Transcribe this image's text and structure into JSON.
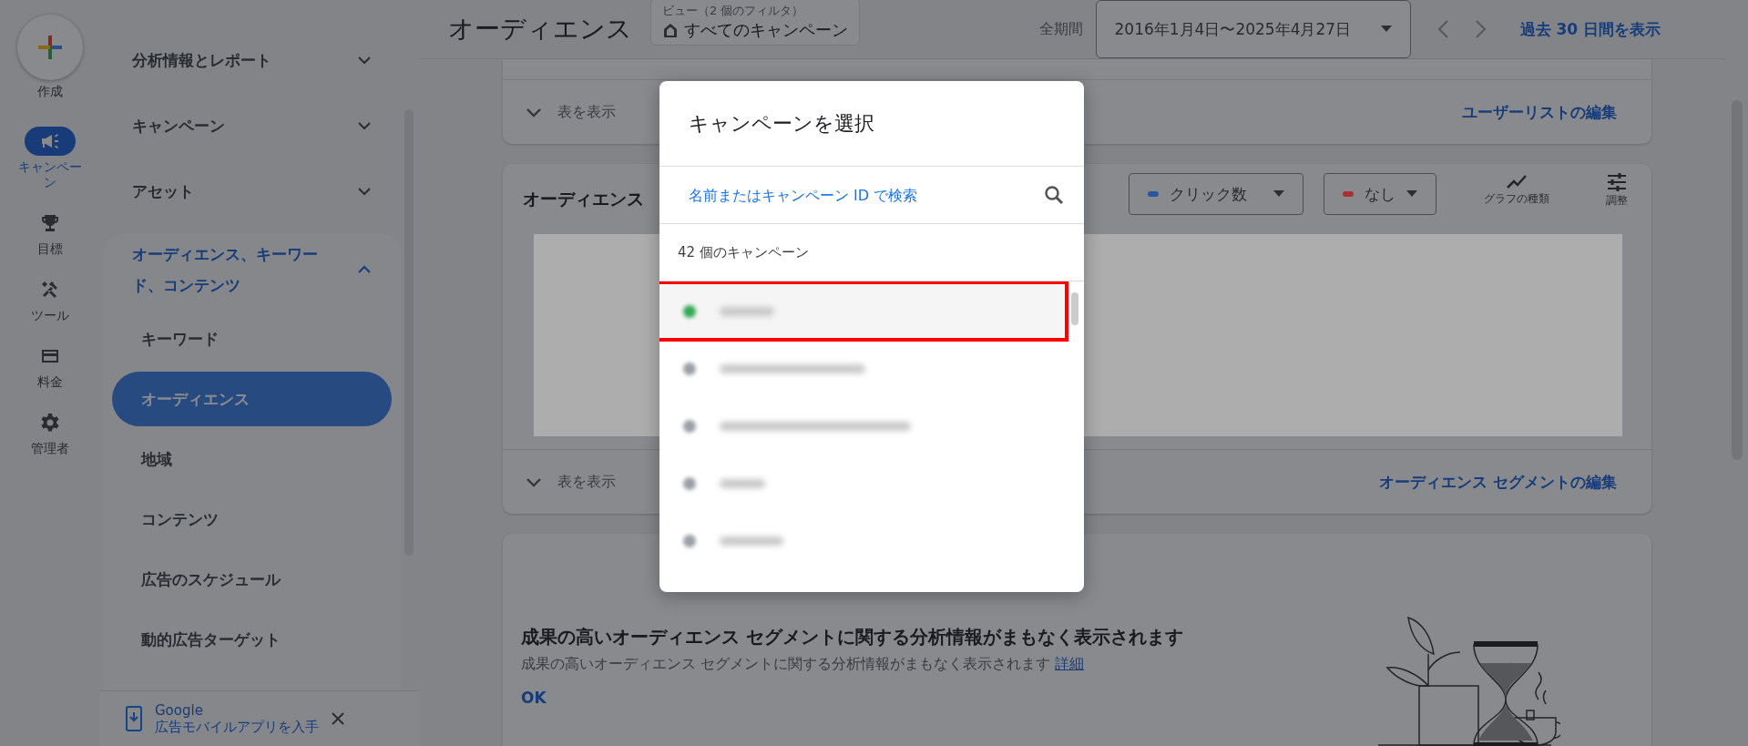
{
  "rail": {
    "create_label": "作成",
    "items": [
      {
        "label": "キャンペーン",
        "kind": "campaign",
        "selected": true
      },
      {
        "label": "目標",
        "kind": "goal",
        "selected": false
      },
      {
        "label": "ツール",
        "kind": "tools",
        "selected": false
      },
      {
        "label": "料金",
        "kind": "billing",
        "selected": false
      },
      {
        "label": "管理者",
        "kind": "admin",
        "selected": false
      }
    ]
  },
  "nav": {
    "items": [
      {
        "label": "分析情報とレポート",
        "expanded": false
      },
      {
        "label": "キャンペーン",
        "expanded": false
      },
      {
        "label": "アセット",
        "expanded": false
      },
      {
        "label": "オーディエンス、キーワード、コンテンツ",
        "expanded": true,
        "children": [
          {
            "label": "キーワード",
            "selected": false
          },
          {
            "label": "オーディエンス",
            "selected": true
          },
          {
            "label": "地域",
            "selected": false
          },
          {
            "label": "コンテンツ",
            "selected": false
          },
          {
            "label": "広告のスケジュール",
            "selected": false
          },
          {
            "label": "動的広告ターゲット",
            "selected": false
          }
        ]
      }
    ]
  },
  "promo": {
    "line_1": "Google",
    "line_2": "広告モバイルアプリを入手"
  },
  "header": {
    "title": "オーディエンス",
    "view_label": "ビュー（2 個のフィルタ）",
    "view_value": "すべてのキャンペーン",
    "period_label": "全期間",
    "date_range": "2016年1月4日〜2025年4月27日",
    "recent_link": "過去 30 日間を表示"
  },
  "user_list_card": {
    "toggle": "表を表示",
    "link": "ユーザーリストの編集"
  },
  "segments_card": {
    "title": "オーディエンス",
    "metrics": [
      {
        "label": "クリック数",
        "color": "#2a56a0"
      },
      {
        "label": "なし",
        "color": "#a83232"
      }
    ],
    "tools": [
      {
        "label": "グラフの種類",
        "kind": "chart"
      },
      {
        "label": "調整",
        "kind": "adjust"
      }
    ],
    "toggle": "表を表示",
    "link": "オーディエンス セグメントの編集"
  },
  "insights_card": {
    "headline": "成果の高いオーディエンス セグメントに関する分析情報がまもなく表示されます",
    "body": "成果の高いオーディエンス セグメントに関する分析情報がまもなく表示されます",
    "link": "詳細",
    "action": "OK"
  },
  "dialog": {
    "title": "キャンペーンを選択",
    "search_placeholder": "名前またはキャンペーン ID で検索",
    "count": "42 個のキャンペーン",
    "rows": [
      {
        "color": "#34a853",
        "highlighted": true
      },
      {
        "color": "#9aa0a6",
        "highlighted": false
      },
      {
        "color": "#9aa0a6",
        "highlighted": false
      },
      {
        "color": "#9aa0a6",
        "highlighted": false
      },
      {
        "color": "#9aa0a6",
        "highlighted": false
      }
    ]
  }
}
